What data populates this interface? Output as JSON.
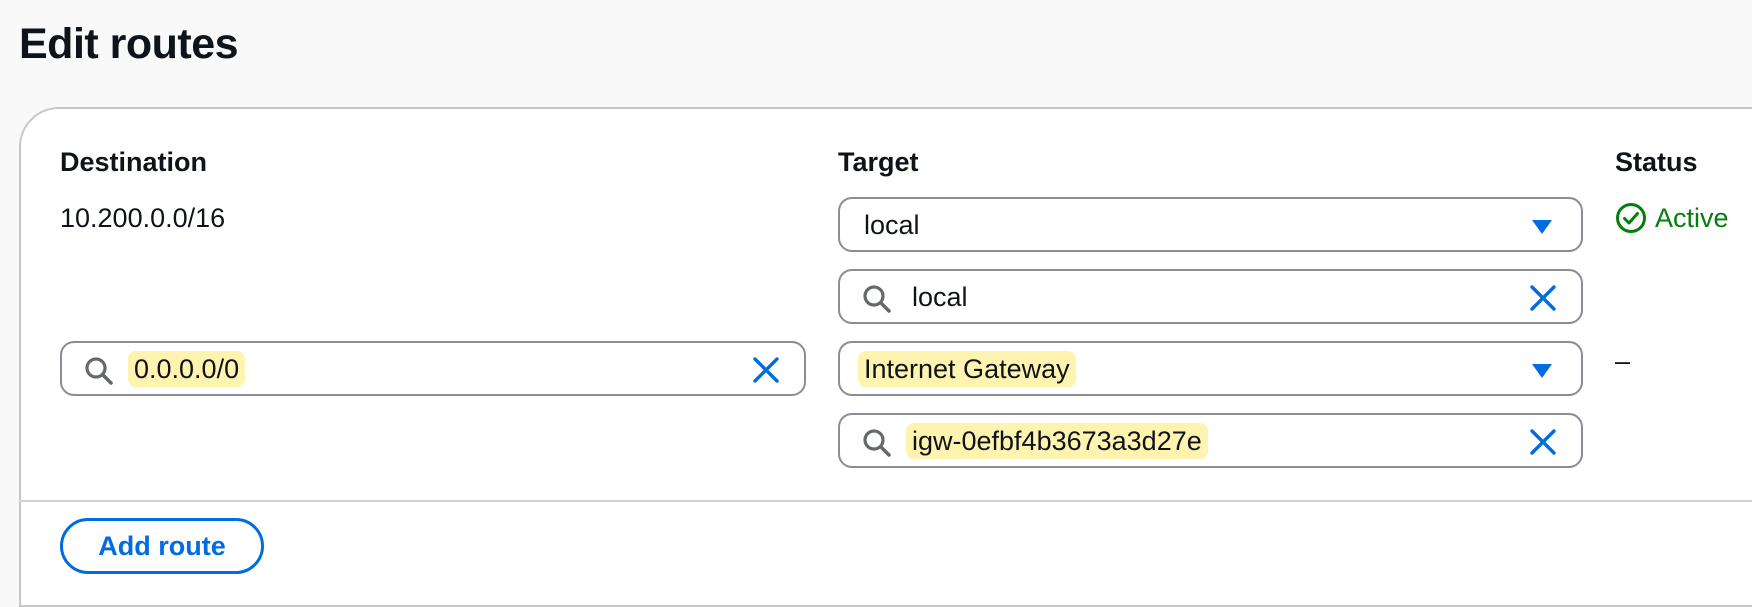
{
  "page": {
    "title": "Edit routes"
  },
  "columns": {
    "destination": "Destination",
    "target": "Target",
    "status": "Status"
  },
  "routes": [
    {
      "destination": "10.200.0.0/16",
      "target_select": "local",
      "target_search": "local",
      "status": "Active"
    },
    {
      "destination_search": "0.0.0.0/0",
      "target_select": "Internet Gateway",
      "target_search": "igw-0efbf4b3673a3d27e",
      "status": "–"
    }
  ],
  "actions": {
    "add_route": "Add route"
  },
  "colors": {
    "accent": "#006ce0",
    "success": "#037f0c",
    "highlight": "#fff3b0",
    "border": "#8c8c94"
  },
  "icons": [
    "search-icon",
    "close-icon",
    "caret-down-icon",
    "check-circle-icon"
  ]
}
